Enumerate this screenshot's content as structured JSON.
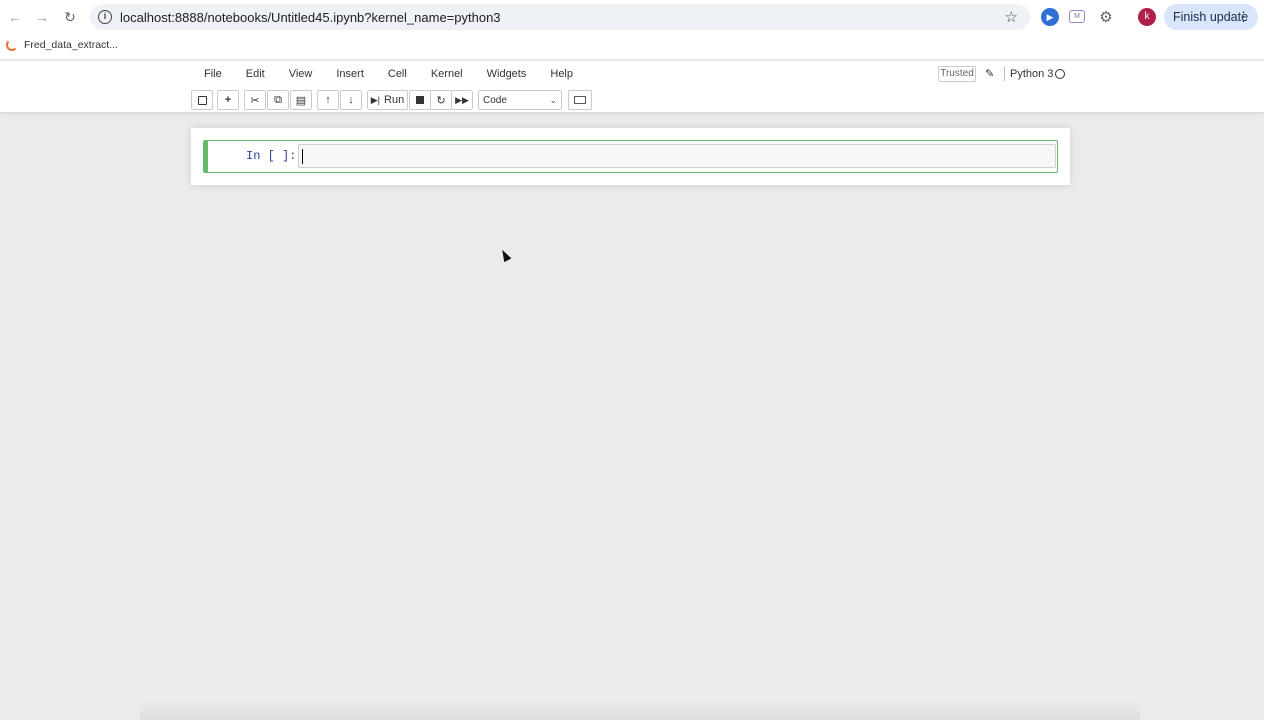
{
  "browser": {
    "url": "localhost:8888/notebooks/Untitled45.ipynb?kernel_name=python3",
    "finish_update_label": "Finish update",
    "avatar_initial": "k",
    "bookmarks": [
      {
        "label": "Fred_data_extract..."
      }
    ]
  },
  "jupyter": {
    "menu": [
      "File",
      "Edit",
      "View",
      "Insert",
      "Cell",
      "Kernel",
      "Widgets",
      "Help"
    ],
    "trusted_label": "Trusted",
    "kernel_name": "Python 3",
    "toolbar": {
      "run_label": "Run",
      "cell_type": "Code"
    },
    "cells": [
      {
        "prompt": "In [ ]:",
        "source": ""
      }
    ]
  },
  "colors": {
    "cell_selected_border": "#66bb6a",
    "prompt": "#303f9f",
    "finish_update_bg": "#d8e5fb",
    "avatar_bg": "#b0214a"
  }
}
